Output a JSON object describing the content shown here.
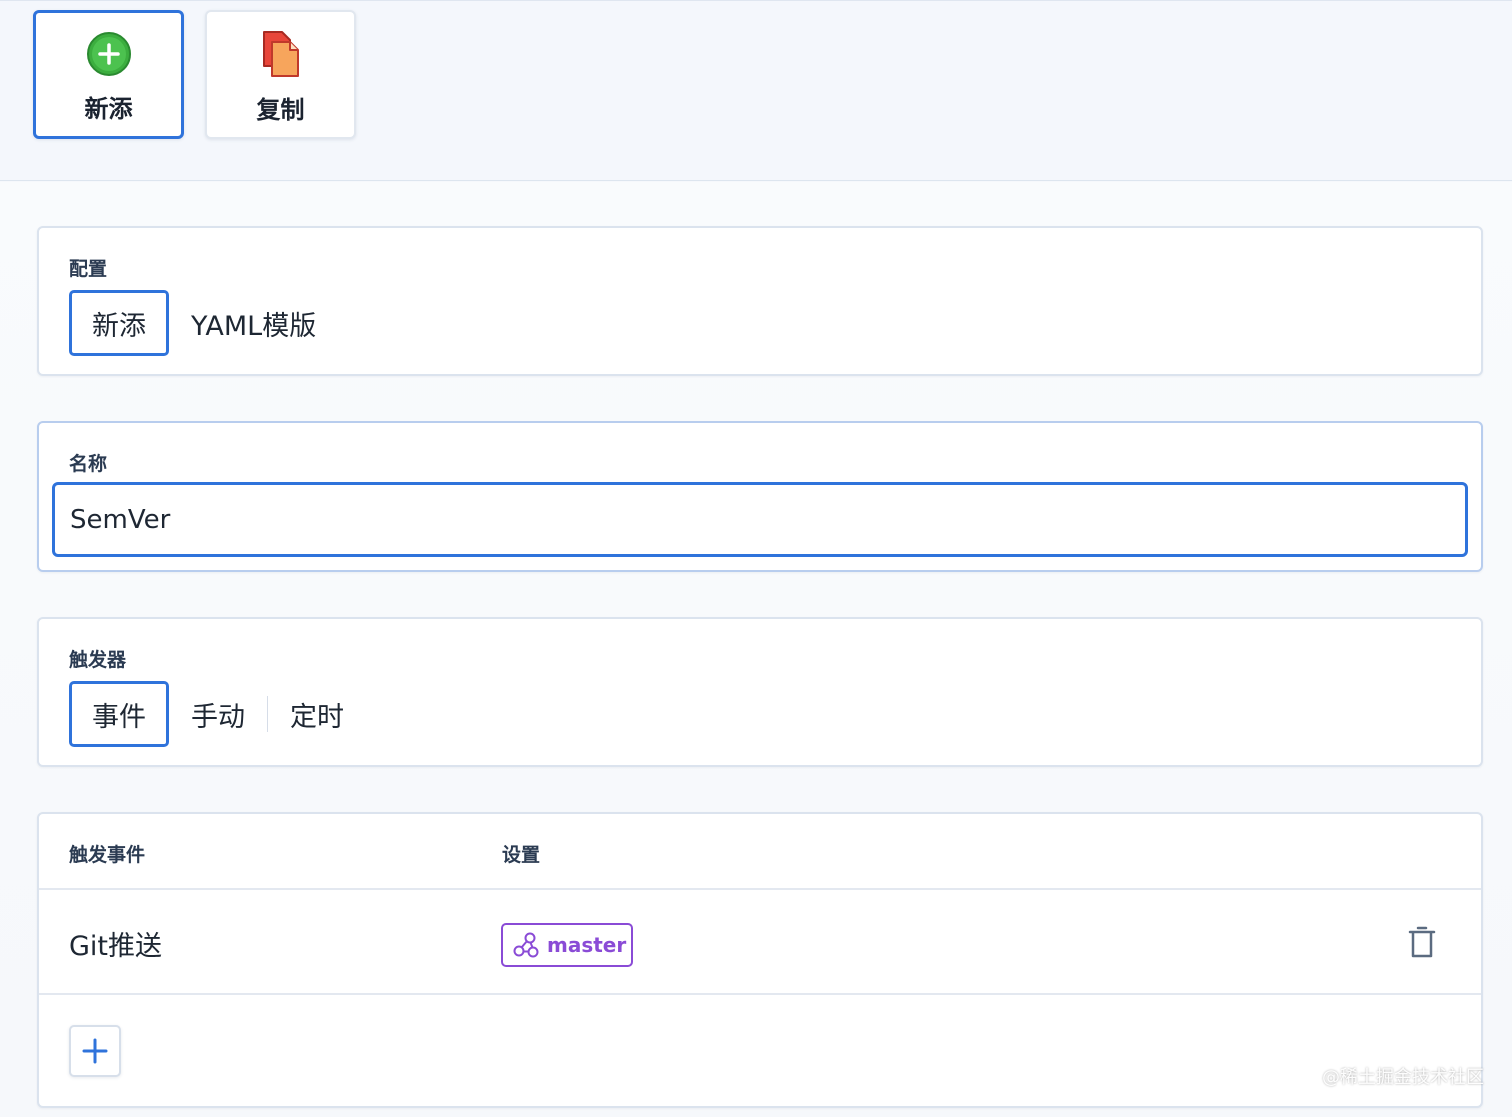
{
  "toolbar": {
    "new_label": "新添",
    "copy_label": "复制"
  },
  "config_card": {
    "label": "配置",
    "options": [
      "新添",
      "YAML模版"
    ],
    "selected": "新添"
  },
  "name_card": {
    "label": "名称",
    "value": "SemVer"
  },
  "trigger_card": {
    "label": "触发器",
    "options": [
      "事件",
      "手动",
      "定时"
    ],
    "selected": "事件"
  },
  "events_table": {
    "columns": [
      "触发事件",
      "设置"
    ],
    "rows": [
      {
        "event": "Git推送",
        "branch": "master"
      }
    ]
  },
  "colors": {
    "accent": "#2f73db",
    "branch_purple": "#8a4bd6",
    "add_green": "#3cae3f"
  },
  "icons": {
    "new": "plus-circle-icon",
    "copy": "copy-documents-icon",
    "branch": "git-branch-icon",
    "delete": "trash-icon",
    "add_row": "plus-icon"
  },
  "watermark": "@稀土掘金技术社区"
}
